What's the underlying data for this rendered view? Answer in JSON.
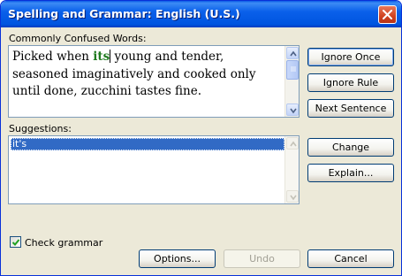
{
  "window": {
    "title": "Spelling and Grammar: English (U.S.)"
  },
  "sentence": {
    "label": "Commonly Confused Words:",
    "label_mnemonic": "C",
    "before": "Picked when ",
    "error_word": "its",
    "after": " young and tender, seasoned imaginatively and cooked only until done, zucchini tastes fine.",
    "error_color": "#1f7a1f"
  },
  "suggestions": {
    "label": "Suggestions:",
    "items": [
      "it's"
    ],
    "selected_index": 0,
    "selection_color": "#316ac5"
  },
  "buttons": {
    "ignore_once": "Ignore Once",
    "ignore_rule": "Ignore Rule",
    "next_sentence": "Next Sentence",
    "change": "Change",
    "explain": "Explain...",
    "options": "Options...",
    "undo": "Undo",
    "cancel": "Cancel"
  },
  "check_grammar": {
    "label": "Check grammar",
    "checked": true
  },
  "icons": {
    "close": "close-icon",
    "scroll_up": "arrow-up-icon",
    "scroll_down": "arrow-down-icon",
    "check": "checkmark-icon"
  },
  "colors": {
    "titlebar": "#0a5ae6",
    "dialog_bg": "#ece9d8",
    "close_button": "#d0421f"
  }
}
